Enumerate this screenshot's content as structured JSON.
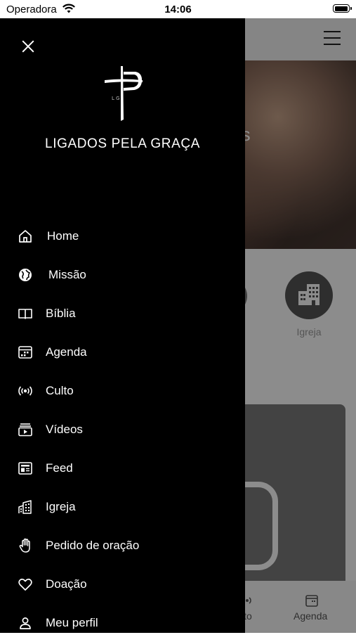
{
  "status_bar": {
    "carrier": "Operadora",
    "time": "14:06",
    "battery_level": 0.9
  },
  "drawer": {
    "brand_name": "LIGADOS PELA GRAÇA",
    "logo_letters": "L G",
    "items": [
      {
        "label": "Home",
        "icon": "home-icon"
      },
      {
        "label": "Missão",
        "icon": "globe-icon"
      },
      {
        "label": "Bíblia",
        "icon": "book-icon"
      },
      {
        "label": "Agenda",
        "icon": "calendar-icon"
      },
      {
        "label": "Culto",
        "icon": "broadcast-icon"
      },
      {
        "label": "Vídeos",
        "icon": "video-icon"
      },
      {
        "label": "Feed",
        "icon": "newspaper-icon"
      },
      {
        "label": "Igreja",
        "icon": "building-icon"
      },
      {
        "label": "Pedido de oração",
        "icon": "hand-icon"
      },
      {
        "label": "Doação",
        "icon": "heart-icon"
      },
      {
        "label": "Meu perfil",
        "icon": "user-icon"
      }
    ]
  },
  "background": {
    "banner_text_fragment": "tos",
    "shortcut_label": "Igreja",
    "tab_labels": [
      "lto",
      "Agenda"
    ]
  },
  "colors": {
    "drawer_bg": "#000000",
    "text": "#ffffff"
  }
}
